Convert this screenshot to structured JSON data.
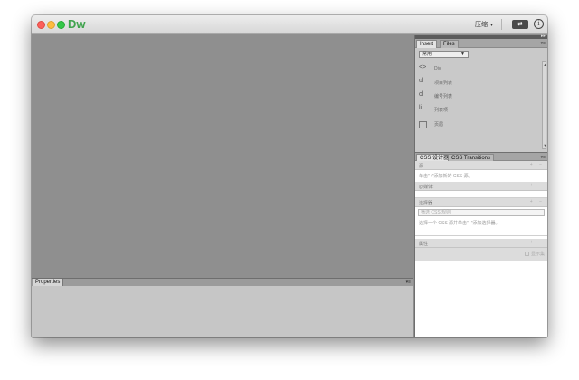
{
  "titlebar": {
    "app_logo": "Dw",
    "layout_menu": "压缩",
    "layout_caret": "▾",
    "sync_label": "⇄",
    "info_label": "i"
  },
  "properties": {
    "tab_label": "Properties",
    "menu_label": "▾≡"
  },
  "right_panel": {
    "dock_label": "▸▸",
    "insert_tabs": [
      {
        "label": "Insert",
        "active": true
      },
      {
        "label": "Files",
        "active": false
      }
    ],
    "panel_menu": "▾≡",
    "category": "常用",
    "insert_items": [
      {
        "glyph": "<>",
        "label": "Div"
      },
      {
        "glyph": "ul",
        "label": "项目列表"
      },
      {
        "glyph": "ol",
        "label": "编号列表"
      },
      {
        "glyph": "li",
        "label": "列表项"
      },
      {
        "glyph": "",
        "label": "页眉"
      }
    ],
    "css_tabs": [
      {
        "label": "CSS 设计器",
        "active": true
      },
      {
        "label": "CSS Transitions",
        "active": false
      }
    ],
    "css_designer": {
      "source_title": "源",
      "source_hint": "单击\"+\"添加新的 CSS 源。",
      "media_title": "@媒体:",
      "selector_title": "选择器",
      "selector_placeholder": "筛选 CSS 规则",
      "selector_hint": "选择一个 CSS 源并单击\"+\"添加选择器。",
      "properties_title": "属性",
      "show_set_label": "显示集",
      "plus_minus": "+ −"
    }
  }
}
